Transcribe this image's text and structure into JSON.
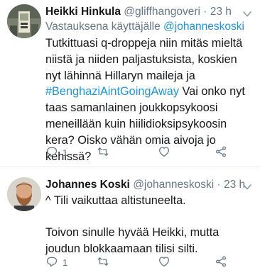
{
  "tweets": [
    {
      "display_name": "Heikki Hinkula",
      "handle": "@gliffhangoveri",
      "dot": "·",
      "time": "23 h",
      "replying_prefix": "Vastauksena käyttäjälle",
      "replying_handle": "@johanneskoski",
      "text_part1": "Tutkittuasi q-droppeja niin mitäs mieltä niistä ja niiden paljastuksista, koskien nyt lähinnä Hillaryn maileja ja ",
      "text_hashtag": "#BenghaziAintGoingAway",
      "text_part2": " Vai onko nyt taas samanlainen joukkopsykoosi meneillään kuin hiilidioksipsykoosin kera? Oisko vähän omia aivoja jo kehissä?",
      "reply_count": "1"
    },
    {
      "display_name": "Johannes Koski",
      "handle": "@johanneskoski",
      "dot": "·",
      "time": "23 h",
      "paragraph1": "^ Tili vaikuttaa altistuneelta.",
      "paragraph2": "Toivon sinulle hyvää Heikki, mutta joudun blokkaamaan tilisi silti.",
      "reply_count": "1"
    }
  ],
  "icons": {
    "reply": "reply-icon",
    "retweet": "retweet-icon",
    "like": "heart-icon",
    "share": "share-icon",
    "caret": "chevron-down-icon"
  },
  "colors": {
    "text": "#14171a",
    "secondary": "#657786",
    "link": "#1b95e0",
    "divider": "#e6ecf0"
  }
}
